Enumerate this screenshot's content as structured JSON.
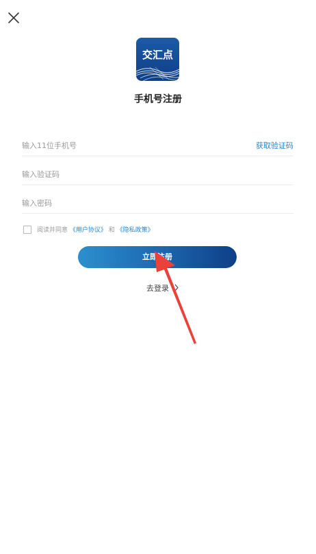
{
  "header": {
    "close_icon": "close-icon"
  },
  "logo": {
    "text": "交汇点"
  },
  "title": "手机号注册",
  "form": {
    "phone_placeholder": "输入11位手机号",
    "get_code_label": "获取验证码",
    "code_placeholder": "输入验证码",
    "password_placeholder": "输入密码",
    "agree_prefix": "阅读并同意",
    "user_agreement": "《用户协议》",
    "and_text": "和",
    "privacy_policy": "《隐私政策》",
    "agreed": false
  },
  "register_button_label": "立即注册",
  "login_link_label": "去登录",
  "colors": {
    "link": "#2a86cf",
    "brand_dark": "#0e3f87",
    "annotation_arrow": "#e8423a"
  }
}
